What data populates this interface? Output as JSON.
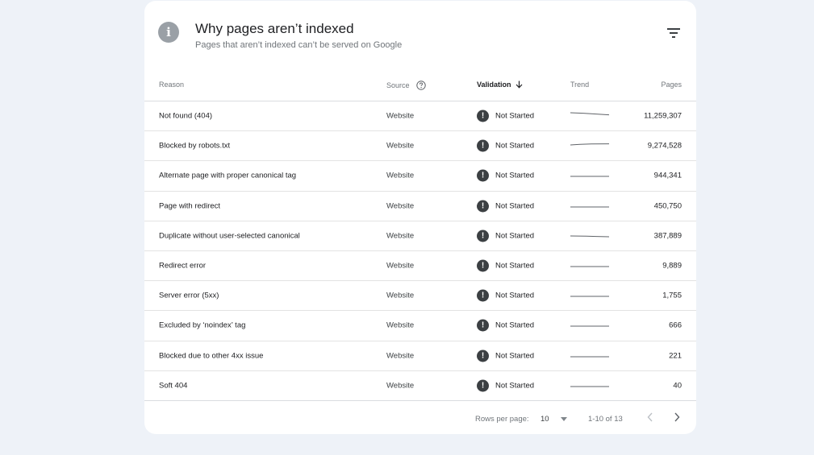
{
  "header": {
    "title": "Why pages aren’t indexed",
    "subtitle": "Pages that aren’t indexed can’t be served on Google",
    "info_icon": "info-icon",
    "filter_icon": "filter-icon"
  },
  "table": {
    "columns": {
      "reason": "Reason",
      "source": "Source",
      "validation": "Validation",
      "trend": "Trend",
      "pages": "Pages"
    },
    "rows": [
      {
        "reason": "Not found (404)",
        "source": "Website",
        "validation": "Not Started",
        "pages": "11,259,307"
      },
      {
        "reason": "Blocked by robots.txt",
        "source": "Website",
        "validation": "Not Started",
        "pages": "9,274,528"
      },
      {
        "reason": "Alternate page with proper canonical tag",
        "source": "Website",
        "validation": "Not Started",
        "pages": "944,341"
      },
      {
        "reason": "Page with redirect",
        "source": "Website",
        "validation": "Not Started",
        "pages": "450,750"
      },
      {
        "reason": "Duplicate without user-selected canonical",
        "source": "Website",
        "validation": "Not Started",
        "pages": "387,889"
      },
      {
        "reason": "Redirect error",
        "source": "Website",
        "validation": "Not Started",
        "pages": "9,889"
      },
      {
        "reason": "Server error (5xx)",
        "source": "Website",
        "validation": "Not Started",
        "pages": "1,755"
      },
      {
        "reason": "Excluded by ‘noindex’ tag",
        "source": "Website",
        "validation": "Not Started",
        "pages": "666"
      },
      {
        "reason": "Blocked due to other 4xx issue",
        "source": "Website",
        "validation": "Not Started",
        "pages": "221"
      },
      {
        "reason": "Soft 404",
        "source": "Website",
        "validation": "Not Started",
        "pages": "40"
      }
    ]
  },
  "footer": {
    "rows_per_page_label": "Rows per page:",
    "rows_per_page_value": "10",
    "range": "1-10 of 13"
  },
  "colors": {
    "background": "#eef2f8",
    "card": "#ffffff",
    "warning": "#3c4043",
    "trend_line": "#5f6368"
  }
}
